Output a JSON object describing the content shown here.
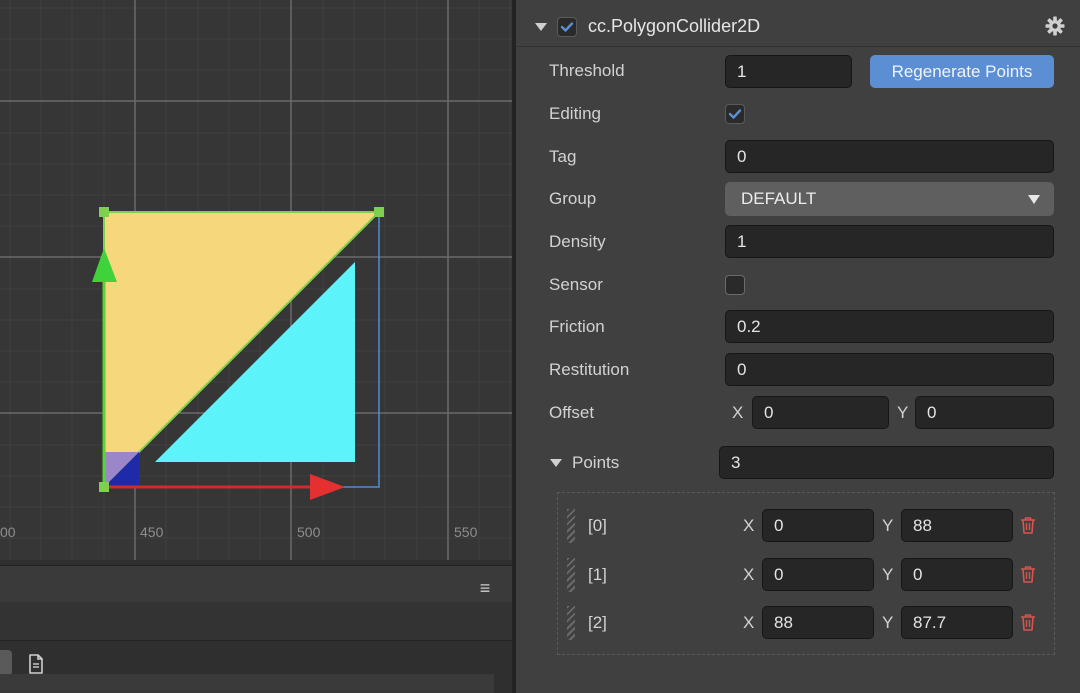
{
  "scene": {
    "tick_labels": [
      "00",
      "450",
      "500",
      "550"
    ]
  },
  "component": {
    "title": "cc.PolygonCollider2D",
    "enabled": true
  },
  "props": {
    "threshold": {
      "label": "Threshold",
      "value": "1"
    },
    "regenerate_label": "Regenerate Points",
    "editing": {
      "label": "Editing",
      "checked": true
    },
    "tag": {
      "label": "Tag",
      "value": "0"
    },
    "group": {
      "label": "Group",
      "value": "DEFAULT"
    },
    "density": {
      "label": "Density",
      "value": "1"
    },
    "sensor": {
      "label": "Sensor",
      "checked": false
    },
    "friction": {
      "label": "Friction",
      "value": "0.2"
    },
    "restitution": {
      "label": "Restitution",
      "value": "0"
    },
    "offset": {
      "label": "Offset",
      "x_label": "X",
      "x": "0",
      "y_label": "Y",
      "y": "0"
    },
    "points": {
      "label": "Points",
      "count": "3"
    }
  },
  "points": [
    {
      "index": "[0]",
      "x_label": "X",
      "x": "0",
      "y_label": "Y",
      "y": "88"
    },
    {
      "index": "[1]",
      "x_label": "X",
      "x": "0",
      "y_label": "Y",
      "y": "0"
    },
    {
      "index": "[2]",
      "x_label": "X",
      "x": "88",
      "y_label": "Y",
      "y": "87.7"
    }
  ],
  "icons": {
    "menu": "hamburger-menu-icon",
    "doc": "document-icon",
    "gear": "gear-icon",
    "trash": "trash-icon"
  },
  "colors": {
    "accent": "#5b8ed3",
    "yellow_poly": "#f6d77c",
    "cyan_sprite": "#5df3fb",
    "trash": "#d9534f"
  }
}
